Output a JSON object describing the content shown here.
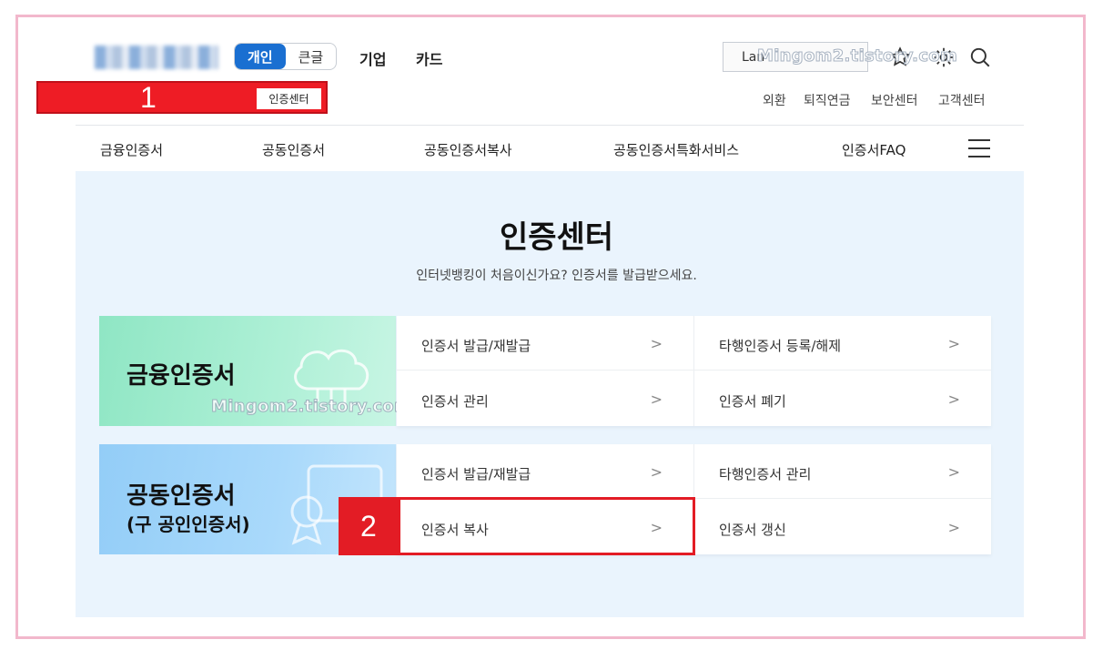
{
  "header": {
    "tabs": [
      {
        "label": "개인",
        "active": true
      },
      {
        "label": "큰글",
        "active": false
      }
    ],
    "nav": [
      "기업",
      "카드"
    ],
    "language_box": "Lan",
    "icons": [
      "star-icon",
      "gear-icon",
      "search-icon"
    ]
  },
  "watermark": "Mingom2.tistory.com",
  "annotations": {
    "one": "1",
    "two": "2"
  },
  "cert_center_link": "인증센터",
  "util_links": [
    "외환",
    "퇴직연금",
    "보안센터",
    "고객센터"
  ],
  "gnb": [
    "금융인증서",
    "공동인증서",
    "공동인증서복사",
    "공동인증서특화서비스",
    "인증서FAQ"
  ],
  "main": {
    "title": "인증센터",
    "subtitle": "인터넷뱅킹이 처음이신가요? 인증서를 발급받으세요."
  },
  "sections": [
    {
      "label": "금융인증서",
      "sublabel": "",
      "color": "#8fe6c4",
      "links": [
        "인증서 발급/재발급",
        "타행인증서 등록/해제",
        "인증서 관리",
        "인증서 폐기"
      ]
    },
    {
      "label": "공동인증서",
      "sublabel": "(구 공인인증서)",
      "color": "#9fd3fa",
      "links": [
        "인증서 발급/재발급",
        "타행인증서 관리",
        "인증서 복사",
        "인증서 갱신"
      ]
    }
  ],
  "chevron": ">",
  "colors": {
    "accent": "#1a6fd1",
    "annotation": "#ee1c25",
    "frame": "#f2b8cc",
    "main_bg": "#eaf4fd"
  }
}
